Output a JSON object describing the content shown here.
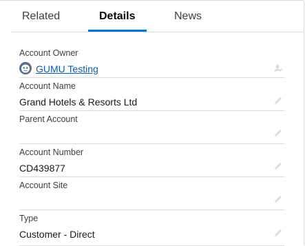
{
  "tabs": [
    {
      "label": "Related",
      "active": false
    },
    {
      "label": "Details",
      "active": true
    },
    {
      "label": "News",
      "active": false
    }
  ],
  "accent_color": "#0176d3",
  "fields": {
    "account_owner": {
      "label": "Account Owner",
      "value": "GUMU Testing",
      "icon": "user-avatar-icon",
      "action_icon": "change-owner-icon"
    },
    "account_name": {
      "label": "Account Name",
      "value": "Grand Hotels & Resorts Ltd",
      "action_icon": "pencil-icon"
    },
    "parent_account": {
      "label": "Parent Account",
      "value": "",
      "action_icon": "pencil-icon"
    },
    "account_number": {
      "label": "Account Number",
      "value": "CD439877",
      "action_icon": "pencil-icon"
    },
    "account_site": {
      "label": "Account Site",
      "value": "",
      "action_icon": "pencil-icon"
    },
    "type": {
      "label": "Type",
      "value": "Customer - Direct",
      "action_icon": "pencil-icon"
    }
  }
}
